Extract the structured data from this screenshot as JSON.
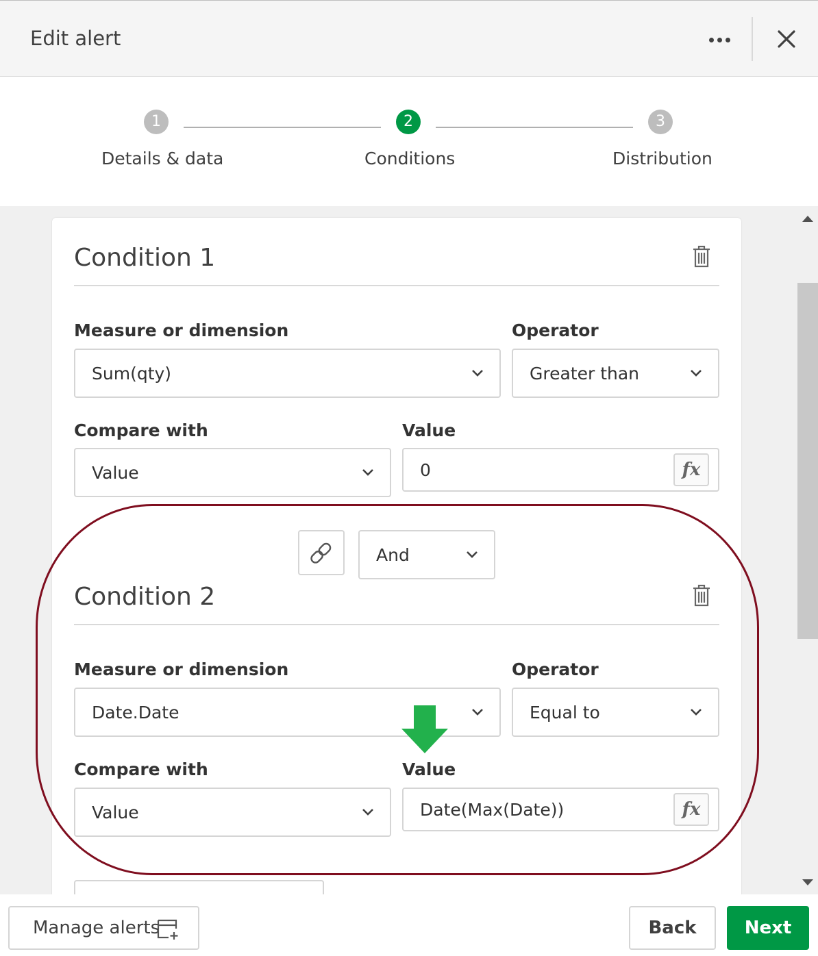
{
  "header": {
    "title": "Edit alert"
  },
  "stepper": {
    "steps": [
      {
        "number": "1",
        "label": "Details & data"
      },
      {
        "number": "2",
        "label": "Conditions"
      },
      {
        "number": "3",
        "label": "Distribution"
      }
    ],
    "active_step": 2
  },
  "conditions": [
    {
      "title": "Condition 1",
      "measure_label": "Measure or dimension",
      "measure_value": "Sum(qty)",
      "operator_label": "Operator",
      "operator_value": "Greater than",
      "compare_label": "Compare with",
      "compare_value": "Value",
      "value_label": "Value",
      "value_value": "0"
    },
    {
      "title": "Condition 2",
      "measure_label": "Measure or dimension",
      "measure_value": "Date.Date",
      "operator_label": "Operator",
      "operator_value": "Equal to",
      "compare_label": "Compare with",
      "compare_value": "Value",
      "value_label": "Value",
      "value_value": "Date(Max(Date))"
    }
  ],
  "connector": {
    "logic_value": "And"
  },
  "fx_label": "fx",
  "footer": {
    "manage_label": "Manage alerts",
    "back_label": "Back",
    "next_label": "Next"
  },
  "colors": {
    "primary": "#009845",
    "highlight": "#7f0e1f",
    "arrow": "#22b14c",
    "step_inactive": "#bdbdbd"
  }
}
